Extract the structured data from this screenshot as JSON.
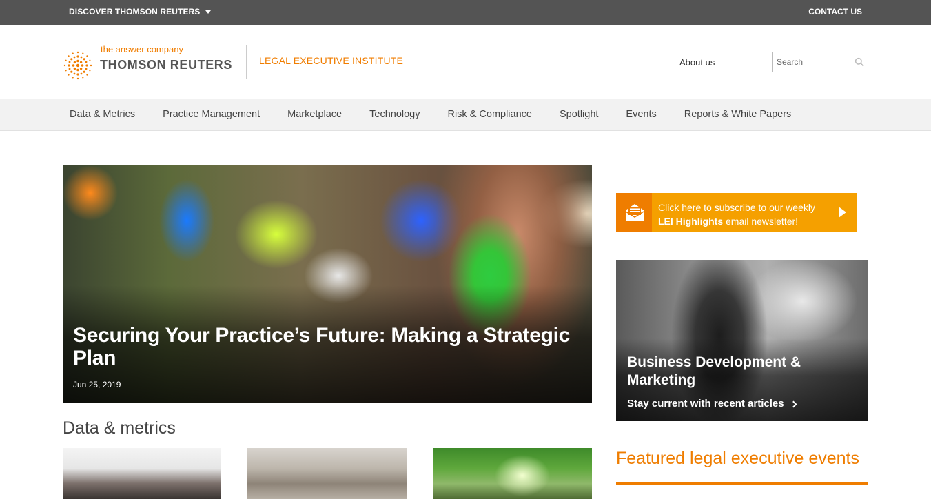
{
  "topbar": {
    "discover_label": "DISCOVER THOMSON REUTERS",
    "contact_label": "CONTACT US"
  },
  "header": {
    "tagline": "the answer company",
    "brand": "THOMSON REUTERS",
    "site_title": "LEGAL EXECUTIVE INSTITUTE",
    "about_label": "About us",
    "search_placeholder": "Search"
  },
  "nav": {
    "items": [
      {
        "label": "Data & Metrics"
      },
      {
        "label": "Practice Management"
      },
      {
        "label": "Marketplace"
      },
      {
        "label": "Technology"
      },
      {
        "label": "Risk & Compliance"
      },
      {
        "label": "Spotlight"
      },
      {
        "label": "Events"
      },
      {
        "label": "Reports & White Papers"
      }
    ]
  },
  "hero": {
    "title": "Securing Your Practice’s Future: Making a Strategic Plan",
    "date": "Jun 25, 2019"
  },
  "sections": {
    "data_metrics_title": "Data & metrics"
  },
  "newsletter": {
    "line1": "Click here to subscribe to our weekly",
    "bold": "LEI Highlights",
    "line2_rest": " email newsletter!"
  },
  "promo": {
    "title": "Business Development & Marketing",
    "cta": "Stay current with recent articles"
  },
  "events": {
    "title": "Featured legal executive events"
  },
  "colors": {
    "accent": "#ef7d00",
    "topbar": "#545454",
    "newsletter": "#f5a000"
  }
}
